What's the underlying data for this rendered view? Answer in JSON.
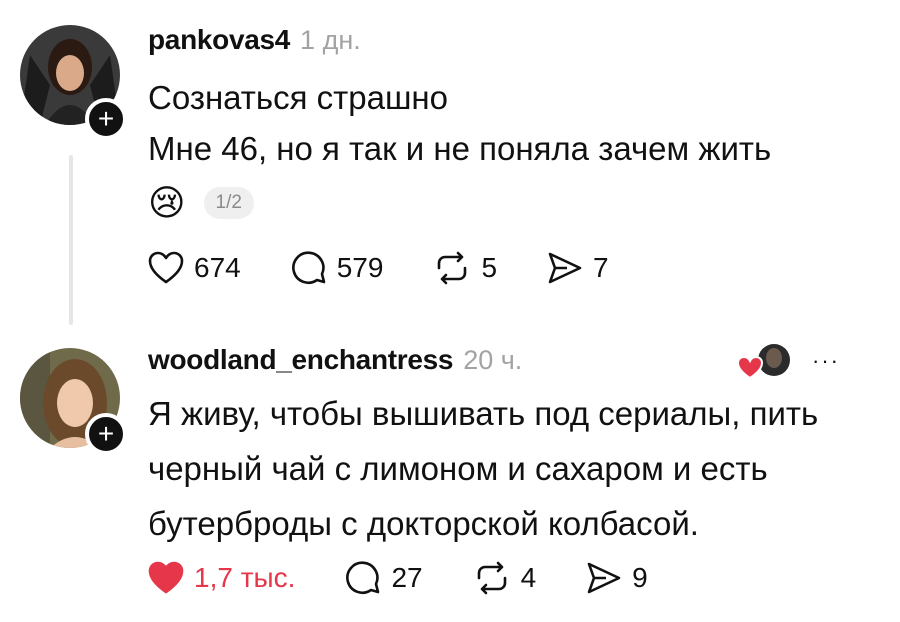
{
  "posts": [
    {
      "username": "pankovas4",
      "time": "1 дн.",
      "lines": [
        "Сознаться страшно",
        "Мне 46, но я так и не поняла зачем жить"
      ],
      "reaction_emoji": "😢",
      "pagination": "1/2",
      "likes": "674",
      "comments": "579",
      "reposts": "5",
      "shares": "7",
      "liked": false
    },
    {
      "username": "woodland_enchantress",
      "time": "20 ч.",
      "lines": [
        "Я живу, чтобы вышивать под сериалы, пить",
        "черный чай с лимоном и сахаром и есть",
        "бутерброды с докторской колбасой."
      ],
      "likes": "1,7 тыс.",
      "comments": "27",
      "reposts": "4",
      "shares": "9",
      "liked": true,
      "more": "···"
    }
  ],
  "icons": {
    "follow": "+",
    "like": "heart-icon",
    "comment": "comment-bubble-icon",
    "repost": "repost-arrows-icon",
    "share": "send-icon"
  },
  "colors": {
    "like_active": "#e5364a",
    "muted": "#a3a3a3"
  }
}
